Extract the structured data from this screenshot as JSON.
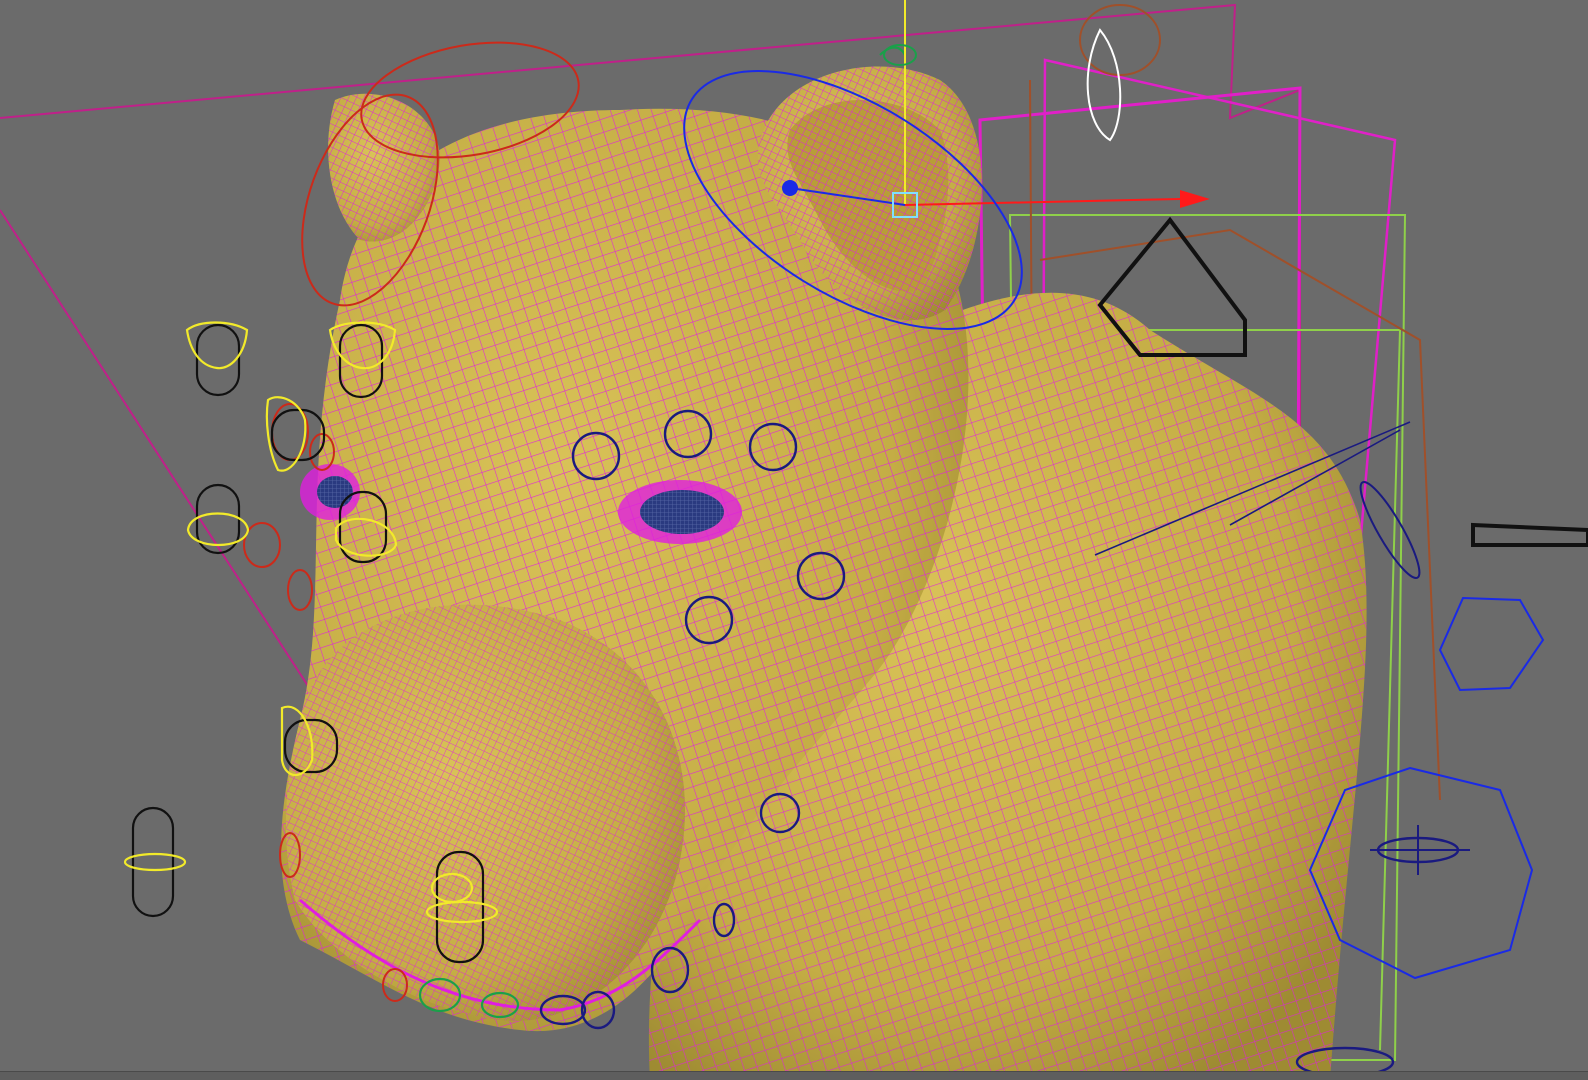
{
  "viewport": {
    "background_color": "#6b6b6b",
    "model": {
      "surface_color": "#c9b24b",
      "wireframe_color": "#e01ee0"
    },
    "controls": {
      "fk_ctrl_color": "#1a1a80",
      "face_ctrl_color": "#f2ea2a",
      "aux_ctrl_color": "#cc2a1a",
      "group_box_color": "#e020c8",
      "guide_color": "#8fd04a",
      "manip_axis_colors": {
        "x": "#ff1a1a",
        "y": "#f2ea2a",
        "z": "#1a2ae6"
      }
    },
    "icons": [
      "move-manipulator-icon",
      "rotate-manipulator-icon"
    ]
  }
}
